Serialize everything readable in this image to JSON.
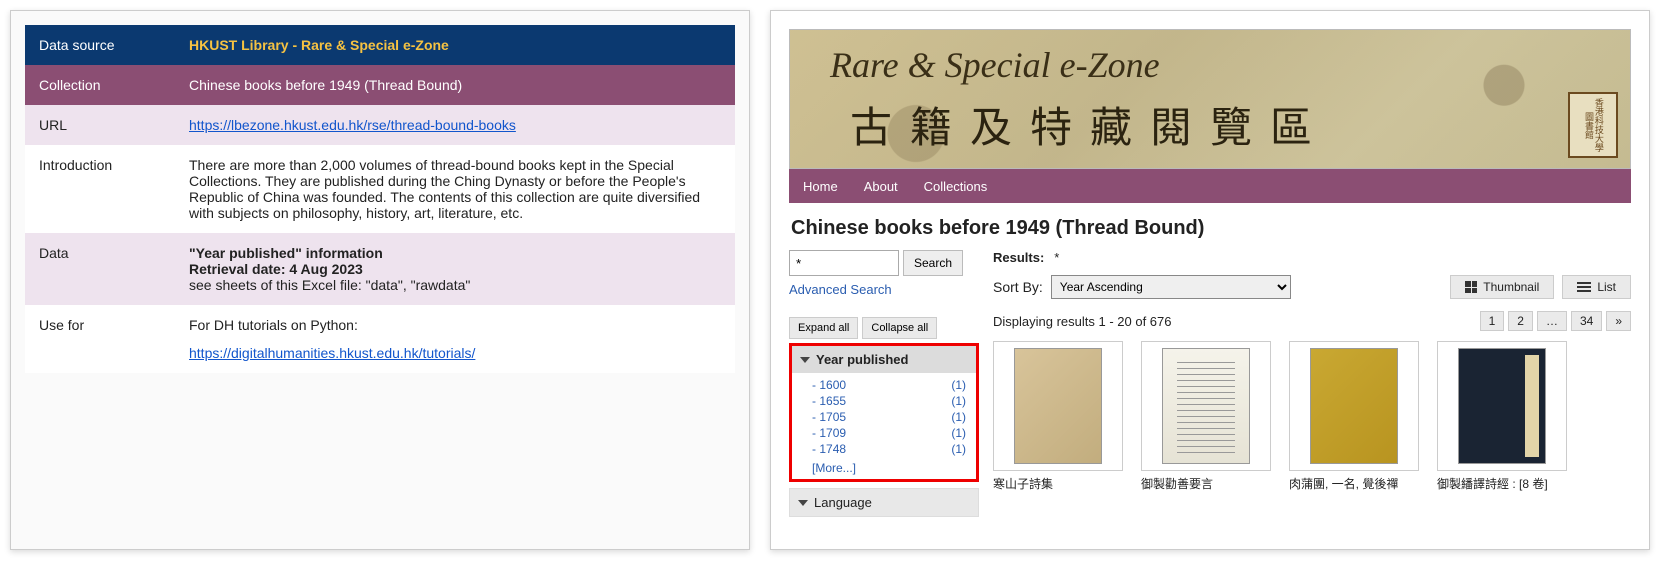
{
  "left_table": {
    "rows": [
      {
        "label": "Data source",
        "value": "HKUST Library - Rare & Special e-Zone"
      },
      {
        "label": "Collection",
        "value": "Chinese books before 1949 (Thread Bound)"
      },
      {
        "label": "URL",
        "url": "https://lbezone.hkust.edu.hk/rse/thread-bound-books"
      },
      {
        "label": "Introduction",
        "value": "There are more than 2,000 volumes of thread-bound books kept in the Special Collections. They are published during the Ching Dynasty or before the People's Republic of China was founded. The contents of this collection are quite diversified with subjects on philosophy, history, art, literature, etc."
      },
      {
        "label": "Data",
        "bold1": "\"Year published\" information",
        "bold2": "Retrieval date: 4 Aug 2023",
        "plain": "see sheets of this Excel file: \"data\", \"rawdata\""
      },
      {
        "label": "Use for",
        "lead": "For DH tutorials on Python:",
        "url": "https://digitalhumanities.hkust.edu.hk/tutorials/"
      }
    ]
  },
  "banner": {
    "title_en": "Rare & Special e-Zone",
    "title_zh": "古籍及特藏閱覽區",
    "stamp": "香港科技大學圖書館"
  },
  "nav": {
    "items": [
      "Home",
      "About",
      "Collections"
    ]
  },
  "page_title": "Chinese books before 1949 (Thread Bound)",
  "search": {
    "value": "*",
    "button": "Search",
    "advanced": "Advanced Search",
    "expand_all": "Expand all",
    "collapse_all": "Collapse all"
  },
  "facet_year": {
    "header": "Year published",
    "items": [
      {
        "year": "1600",
        "count": "(1)"
      },
      {
        "year": "1655",
        "count": "(1)"
      },
      {
        "year": "1705",
        "count": "(1)"
      },
      {
        "year": "1709",
        "count": "(1)"
      },
      {
        "year": "1748",
        "count": "(1)"
      }
    ],
    "more": "[More...]"
  },
  "facet_lang": {
    "header": "Language"
  },
  "results": {
    "label": "Results:",
    "query": "*",
    "sort_label": "Sort By:",
    "sort_value": "Year Ascending",
    "view_thumb": "Thumbnail",
    "view_list": "List",
    "displaying": "Displaying results 1 - 20 of 676",
    "pages": [
      "1",
      "2",
      "…",
      "34",
      "»"
    ]
  },
  "thumbs": [
    {
      "title": "寒山子詩集"
    },
    {
      "title": "御製勸善要言"
    },
    {
      "title": "肉蒲團, 一名, 覺後禪"
    },
    {
      "title": "御製繙譯詩經 : [8 卷]"
    }
  ]
}
